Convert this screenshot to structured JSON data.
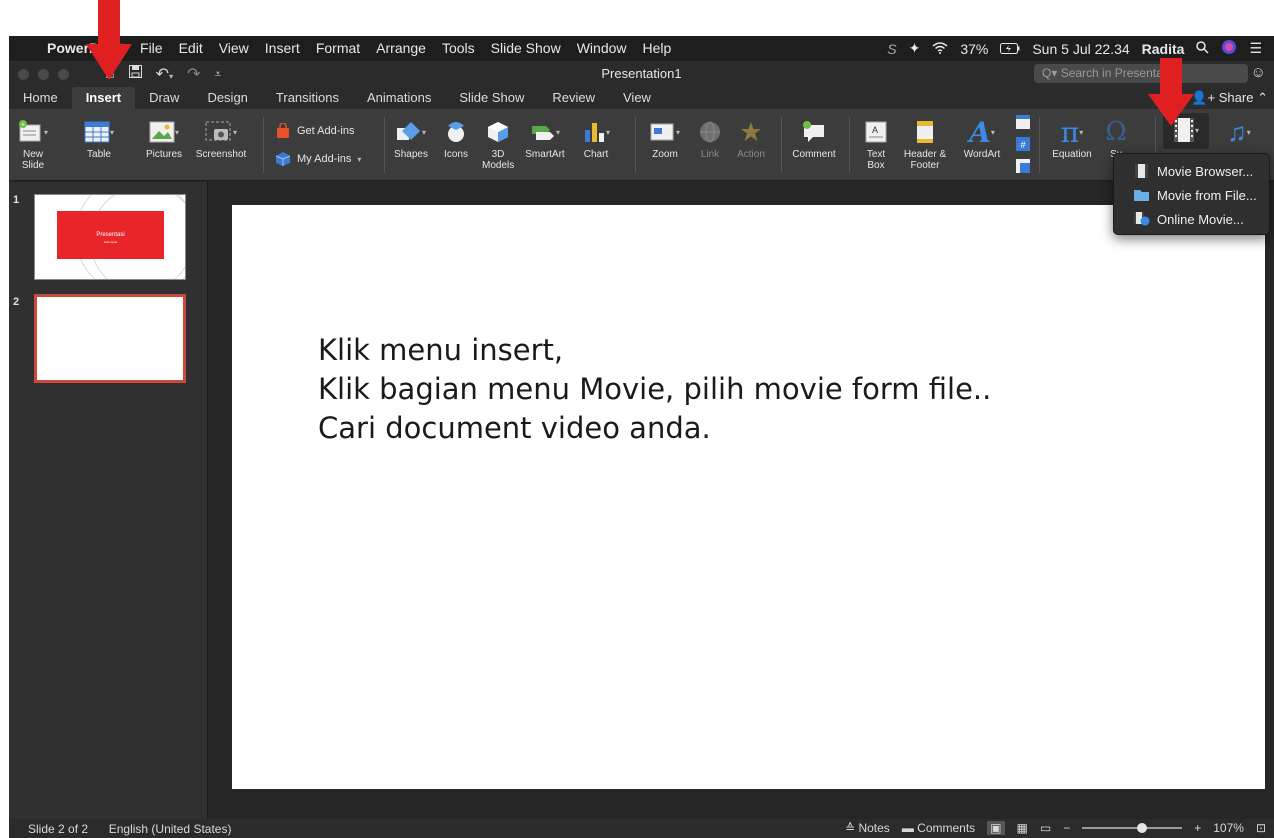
{
  "menubar": {
    "app_name": "PowerPoint",
    "items": [
      "File",
      "Edit",
      "View",
      "Insert",
      "Format",
      "Arrange",
      "Tools",
      "Slide Show",
      "Window",
      "Help"
    ],
    "battery": "37%",
    "datetime": "Sun 5 Jul 22.34",
    "user": "Radita"
  },
  "titlebar": {
    "title": "Presentation1",
    "search_placeholder": "Search in Presentation"
  },
  "tabs": [
    "Home",
    "Insert",
    "Draw",
    "Design",
    "Transitions",
    "Animations",
    "Slide Show",
    "Review",
    "View"
  ],
  "active_tab": "Insert",
  "share_label": "Share",
  "ribbon": {
    "new_slide": "New Slide",
    "table": "Table",
    "pictures": "Pictures",
    "screenshot": "Screenshot",
    "get_addins": "Get Add-ins",
    "my_addins": "My Add-ins",
    "shapes": "Shapes",
    "icons": "Icons",
    "models_3d": "3D Models",
    "smartart": "SmartArt",
    "chart": "Chart",
    "zoom": "Zoom",
    "link": "Link",
    "action": "Action",
    "comment": "Comment",
    "text_box": "Text Box",
    "header_footer": "Header & Footer",
    "wordart": "WordArt",
    "equation": "Equation",
    "symbol": "Sy"
  },
  "movie_menu": [
    "Movie Browser...",
    "Movie from File...",
    "Online Movie..."
  ],
  "thumbnails": [
    {
      "number": "1",
      "title": "Presentasi",
      "subtitle": "Kelompok"
    },
    {
      "number": "2"
    }
  ],
  "slide": {
    "lines": [
      "Klik menu insert,",
      "Klik bagian menu Movie, pilih movie form file..",
      "Cari document video anda."
    ]
  },
  "status": {
    "slide_count": "Slide 2 of 2",
    "language": "English (United States)",
    "notes": "Notes",
    "comments": "Comments",
    "zoom": "107%",
    "zoom_slider_fraction": 0.6
  },
  "colors": {
    "accent_red": "#e8262a",
    "annotation_arrow": "#e02020",
    "ribbon_bg": "#3c3c3c",
    "selected_thumb_border": "#cc4a3a"
  }
}
